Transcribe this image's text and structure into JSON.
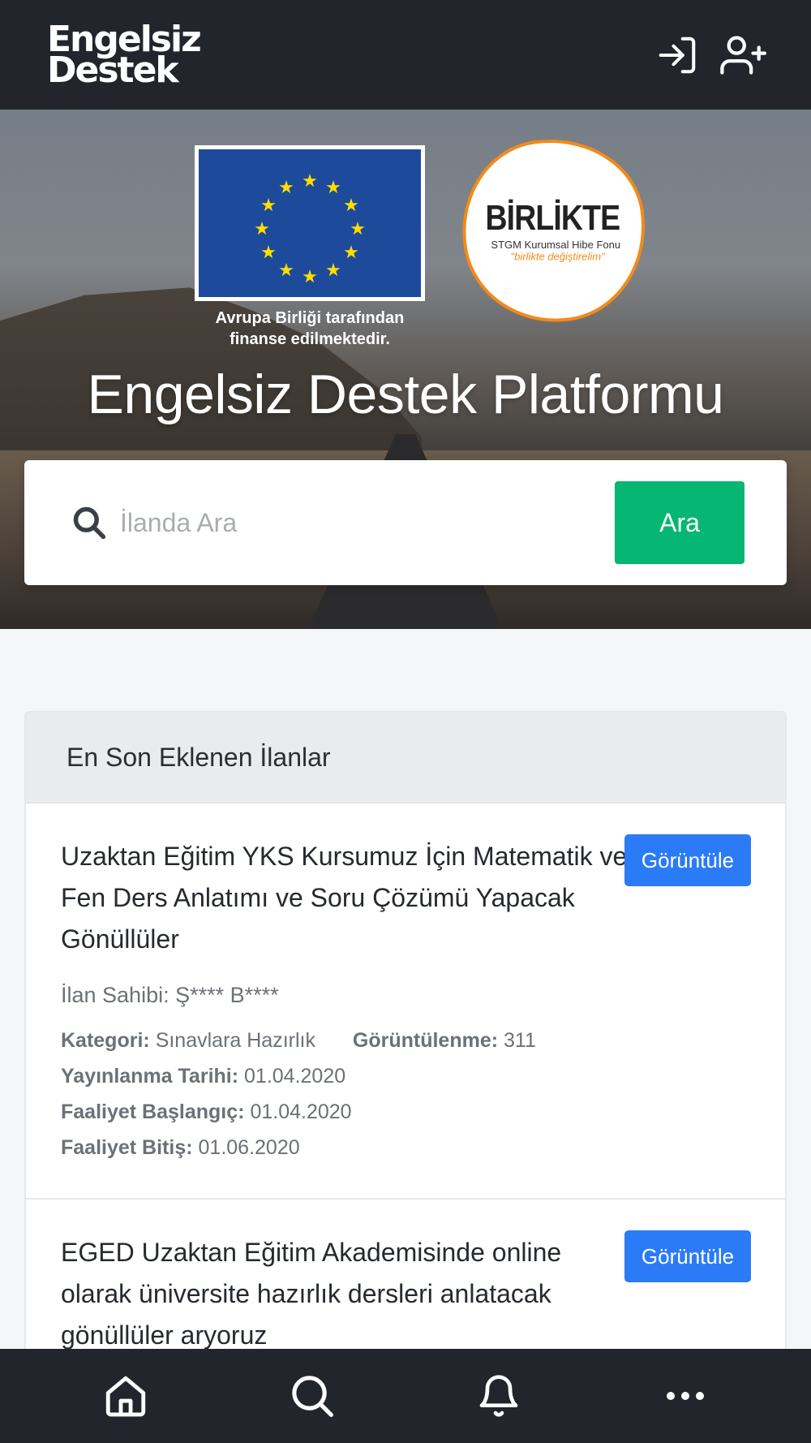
{
  "header": {
    "brand_line1": "Engelsiz",
    "brand_line2": "Destek",
    "login_icon": "login-icon",
    "register_icon": "user-plus-icon"
  },
  "hero": {
    "eu_caption_line1": "Avrupa Birliği tarafından",
    "eu_caption_line2": "finanse edilmektedir.",
    "partner_logo_title": "BİRLİKTE",
    "partner_logo_sub": "STGM Kurumsal Hibe Fonu",
    "partner_logo_slogan": "\"birlikte değiştirelim\"",
    "title": "Engelsiz Destek Platformu"
  },
  "search": {
    "placeholder": "İlanda Ara",
    "value": "",
    "button_label": "Ara"
  },
  "listings": {
    "header": "En Son Eklenen İlanlar",
    "view_label": "Görüntüle",
    "items": [
      {
        "title": "Uzaktan Eğitim YKS Kursumuz İçin Matematik ve Fen Ders Anlatımı ve Soru Çözümü Yapacak Gönüllüler",
        "owner": "İlan Sahibi: Ş**** B****",
        "category_label": "Kategori:",
        "category": "Sınavlara Hazırlık",
        "views_label": "Görüntülenme:",
        "views": "311",
        "published_label": "Yayınlanma Tarihi:",
        "published": "01.04.2020",
        "start_label": "Faaliyet Başlangıç:",
        "start": "01.04.2020",
        "end_label": "Faaliyet Bitiş:",
        "end": "01.06.2020"
      },
      {
        "title": "EGED Uzaktan Eğitim Akademisinde online olarak üniversite hazırlık dersleri anlatacak gönüllüler aryoruz"
      }
    ]
  },
  "bottom_nav": {
    "items": [
      "home-icon",
      "search-icon",
      "bell-icon",
      "more-icon"
    ]
  },
  "colors": {
    "topbar": "#22252b",
    "search_button": "#06b673",
    "view_button": "#2b7bf6",
    "eu_blue": "#1e4a9c",
    "eu_star": "#ffdd00",
    "partner_orange": "#f28a1a"
  }
}
